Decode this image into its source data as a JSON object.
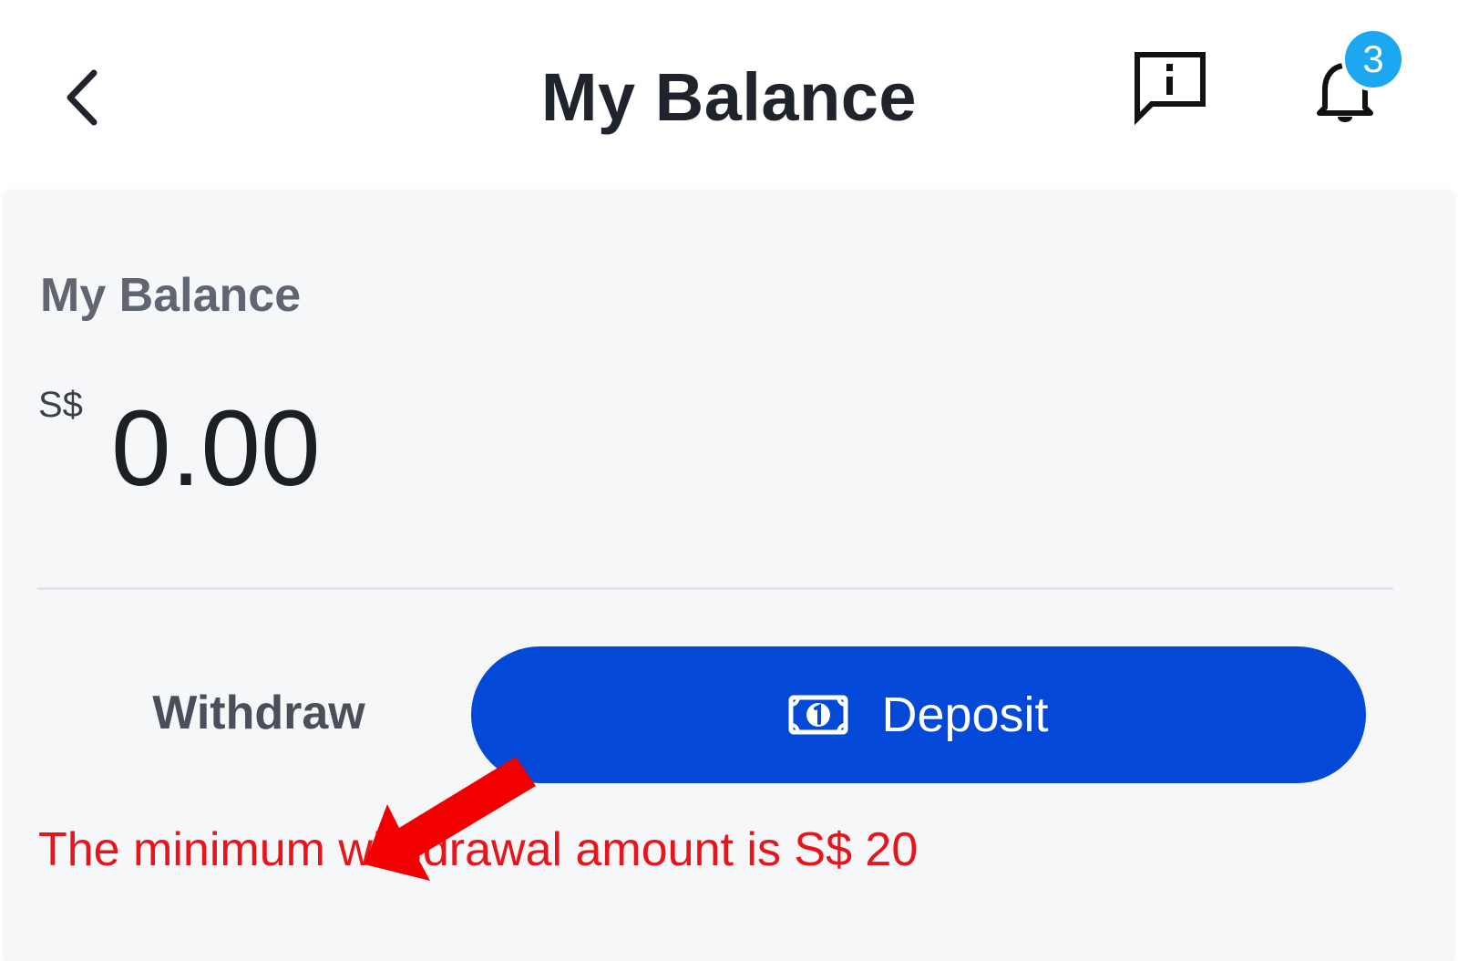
{
  "header": {
    "back_icon": "chevron-left-icon",
    "title": "My Balance",
    "feedback_icon": "feedback-message-icon",
    "notifications_icon": "bell-icon",
    "notification_count": "3"
  },
  "balance": {
    "label": "My Balance",
    "currency": "S$",
    "amount": "0.00"
  },
  "actions": {
    "withdraw_label": "Withdraw",
    "deposit_label": "Deposit",
    "deposit_icon": "banknote-icon"
  },
  "message": {
    "min_withdrawal": "The minimum withdrawal amount is S$ 20"
  },
  "colors": {
    "deposit_button": "#0448d8",
    "badge": "#1ba8f0",
    "error_text": "#e8141b",
    "annotation_arrow": "#f20000"
  }
}
